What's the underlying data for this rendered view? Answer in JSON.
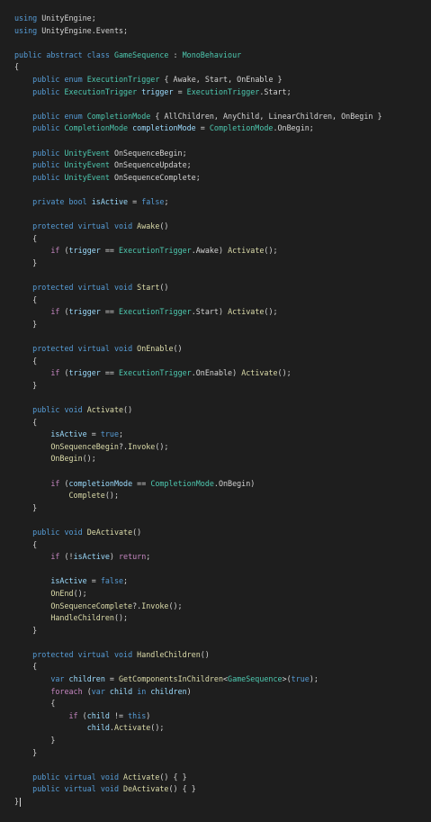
{
  "editor": {
    "background": "#1e1e1e",
    "token_colors": {
      "keyword": "#569cd6",
      "control": "#c586c0",
      "type": "#4ec9b0",
      "function": "#dcdcaa",
      "variable": "#9cdcfe",
      "plain": "#d4d4d4"
    },
    "lines": [
      "using UnityEngine;",
      "using UnityEngine.Events;",
      "",
      "public abstract class GameSequence : MonoBehaviour",
      "{",
      "    public enum ExecutionTrigger { Awake, Start, OnEnable }",
      "    public ExecutionTrigger trigger = ExecutionTrigger.Start;",
      "",
      "    public enum CompletionMode { AllChildren, AnyChild, LinearChildren, OnBegin }",
      "    public CompletionMode completionMode = CompletionMode.OnBegin;",
      "",
      "    public UnityEvent OnSequenceBegin;",
      "    public UnityEvent OnSequenceUpdate;",
      "    public UnityEvent OnSequenceComplete;",
      "",
      "    private bool isActive = false;",
      "",
      "    protected virtual void Awake()",
      "    {",
      "        if (trigger == ExecutionTrigger.Awake) Activate();",
      "    }",
      "",
      "    protected virtual void Start()",
      "    {",
      "        if (trigger == ExecutionTrigger.Start) Activate();",
      "    }",
      "",
      "    protected virtual void OnEnable()",
      "    {",
      "        if (trigger == ExecutionTrigger.OnEnable) Activate();",
      "    }",
      "",
      "    public void Activate()",
      "    {",
      "        isActive = true;",
      "        OnSequenceBegin?.Invoke();",
      "        OnBegin();",
      "",
      "        if (completionMode == CompletionMode.OnBegin)",
      "            Complete();",
      "    }",
      "",
      "    public void DeActivate()",
      "    {",
      "        if (!isActive) return;",
      "",
      "        isActive = false;",
      "        OnEnd();",
      "        OnSequenceComplete?.Invoke();",
      "        HandleChildren();",
      "    }",
      "",
      "    protected virtual void HandleChildren()",
      "    {",
      "        var children = GetComponentsInChildren<GameSequence>(true);",
      "        foreach (var child in children)",
      "        {",
      "            if (child != this)",
      "                child.Activate();",
      "        }",
      "    }",
      "",
      "    public virtual void Activate() { }",
      "    public virtual void DeActivate() { }",
      "}"
    ]
  }
}
